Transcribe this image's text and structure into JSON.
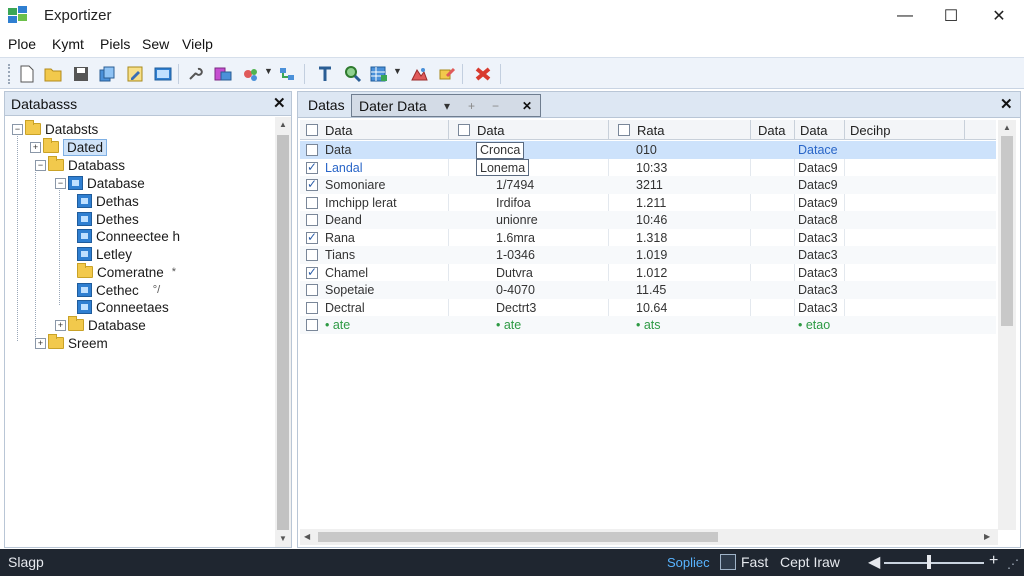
{
  "window": {
    "title": "Exportizer",
    "minimize_glyph": "—",
    "maximize_glyph": "☐",
    "close_glyph": "✕"
  },
  "menu": [
    "Ploe",
    "Kymt",
    "Piels",
    "Sew",
    "Vielp"
  ],
  "toolbar": {
    "icons": [
      "new-icon",
      "open-icon",
      "save-icon",
      "copy-icon",
      "edit-icon",
      "image-icon",
      "wrench-icon",
      "export-icon",
      "settings-icon",
      "network-icon",
      "text-icon",
      "search-icon",
      "table-icon",
      "chart-icon",
      "brush-icon",
      "delete-icon"
    ]
  },
  "left_panel": {
    "title": "Databasss",
    "close_glyph": "✕",
    "tree": [
      {
        "label": "Databsts",
        "icon": "folder",
        "expander": "−"
      },
      {
        "label": "Dated",
        "icon": "folder",
        "expander": "+",
        "selected": true
      },
      {
        "label": "Databass",
        "icon": "folder",
        "expander": "−"
      },
      {
        "label": "Database",
        "icon": "database",
        "expander": "−"
      },
      {
        "label": "Dethas",
        "icon": "database",
        "expander": ""
      },
      {
        "label": "Dethes",
        "icon": "database",
        "expander": ""
      },
      {
        "label": "Conneectee h",
        "icon": "database",
        "expander": ""
      },
      {
        "label": "Letley",
        "icon": "database",
        "expander": ""
      },
      {
        "label": "Comeratne",
        "icon": "folder",
        "expander": "",
        "suffix": "*"
      },
      {
        "label": "Cethec",
        "icon": "database",
        "expander": "",
        "suffix": "°/"
      },
      {
        "label": "Conneetaes",
        "icon": "database",
        "expander": ""
      },
      {
        "label": "Database",
        "icon": "folder",
        "expander": "+"
      },
      {
        "label": "Sreem",
        "icon": "folder",
        "expander": "+"
      }
    ]
  },
  "right_panel": {
    "tabs": [
      {
        "label": "Datas",
        "active": false
      },
      {
        "label": "Dater Data",
        "active": true
      }
    ],
    "tab_controls": [
      "▾",
      "+",
      "−",
      "✕"
    ],
    "close_glyph": "✕",
    "columns": [
      "Data",
      "Data",
      "Rata",
      "Data",
      "Data",
      "Decihp"
    ],
    "rows": [
      {
        "check": false,
        "c1": "Data",
        "c2": "Cronca",
        "c3": "010",
        "c5": "Datace",
        "style": "selected",
        "c1_style": "",
        "c5_style": "link"
      },
      {
        "check": true,
        "c1": "Landal",
        "c2": "Lonema",
        "c3": "10:33",
        "c5": "Datac9",
        "style": "",
        "c1_style": "link",
        "c5_style": ""
      },
      {
        "check": true,
        "c1": "Somoniare",
        "c2": "1/7494",
        "c3": "3211",
        "c5": "Datac9",
        "style": "alt",
        "c1_style": "",
        "c5_style": ""
      },
      {
        "check": false,
        "c1": "Imchipp lerat",
        "c2": "Irdifoa",
        "c3": "1.211",
        "c5": "Datac9",
        "style": "",
        "c1_style": "",
        "c5_style": ""
      },
      {
        "check": false,
        "c1": "Deand",
        "c2": "unionre",
        "c3": "10:46",
        "c5": "Datac8",
        "style": "alt",
        "c1_style": "",
        "c5_style": ""
      },
      {
        "check": true,
        "c1": "Rana",
        "c2": "1.6mra",
        "c3": "1.318",
        "c5": "Datac3",
        "style": "",
        "c1_style": "",
        "c5_style": ""
      },
      {
        "check": false,
        "c1": "Tians",
        "c2": "1-0346",
        "c3": "1.019",
        "c5": "Datac3",
        "style": "alt",
        "c1_style": "",
        "c5_style": ""
      },
      {
        "check": true,
        "c1": "Chamel",
        "c2": "Dutvra",
        "c3": "1.012",
        "c5": "Datac3",
        "style": "",
        "c1_style": "",
        "c5_style": ""
      },
      {
        "check": false,
        "c1": "Sopetaie",
        "c2": "0-4070",
        "c3": "11.45",
        "c5": "Datac3",
        "style": "alt",
        "c1_style": "",
        "c5_style": ""
      },
      {
        "check": false,
        "c1": "Dectral",
        "c2": "Dectrt3",
        "c3": "10.64",
        "c5": "Datac3",
        "style": "",
        "c1_style": "",
        "c5_style": ""
      },
      {
        "check": false,
        "c1": "• ate",
        "c2": "• ate",
        "c3": "• ats",
        "c5": "• etao",
        "style": "alt",
        "c1_style": "green",
        "c5_style": "green"
      }
    ]
  },
  "status": {
    "left": "Slagp",
    "selected": "Sopliec",
    "font": "Fast",
    "zoom_label": "Cept Iraw",
    "zoom_minus": "◀",
    "zoom_plus": "+",
    "zoom_level": 0.45
  },
  "colors": {
    "accent": "#2a66c8",
    "selection": "#cde2fb",
    "status_bg": "#1f2630",
    "green": "#2e9a44"
  }
}
